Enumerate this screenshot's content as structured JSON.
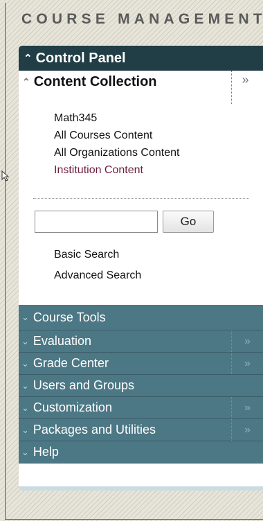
{
  "header": {
    "title": "COURSE MANAGEMENT"
  },
  "control_panel": {
    "title": "Control Panel"
  },
  "content_collection": {
    "title": "Content Collection",
    "expand": "»",
    "links": [
      "Math345",
      "All Courses Content",
      "All Organizations Content",
      "Institution Content"
    ]
  },
  "search": {
    "value": "",
    "go_label": "Go",
    "basic": "Basic Search",
    "advanced": "Advanced Search"
  },
  "nav": {
    "items": [
      {
        "label": "Course Tools",
        "expand": ""
      },
      {
        "label": "Evaluation",
        "expand": "»"
      },
      {
        "label": "Grade Center",
        "expand": "»"
      },
      {
        "label": "Users and Groups",
        "expand": ""
      },
      {
        "label": "Customization",
        "expand": "»"
      },
      {
        "label": "Packages and Utilities",
        "expand": "»"
      },
      {
        "label": "Help",
        "expand": ""
      }
    ]
  },
  "colors": {
    "header_dark": "#213d45",
    "nav_teal": "#4c7784",
    "institution_link": "#6e1b3d"
  },
  "icons": {
    "collapse": "chevron-up-double-icon",
    "expand_nav": "chevron-down-double-icon",
    "flyout": "double-angle-right-icon"
  }
}
